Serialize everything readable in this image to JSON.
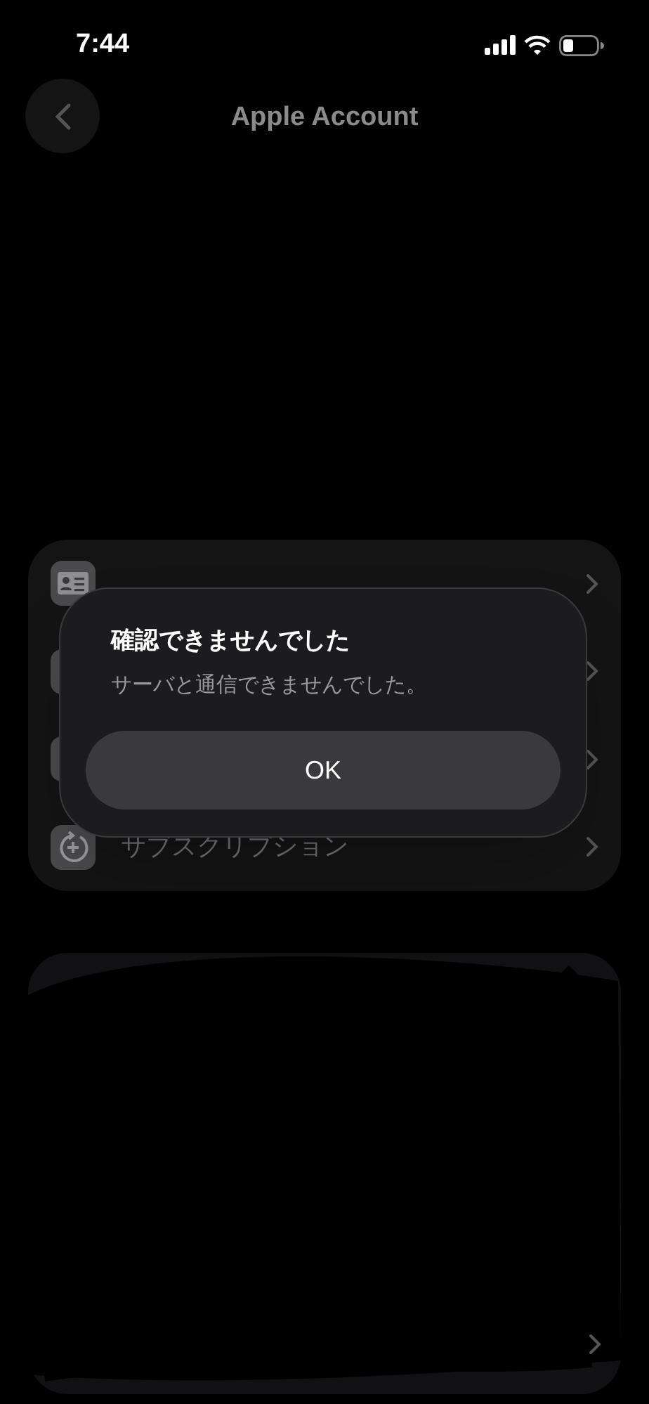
{
  "status_bar": {
    "time": "7:44"
  },
  "nav": {
    "title": "Apple Account"
  },
  "menu": [
    {
      "kind": "contact"
    },
    {
      "kind": "blank"
    },
    {
      "kind": "blank"
    },
    {
      "kind": "subscription",
      "label": "サブスクリプション"
    }
  ],
  "alert": {
    "title": "確認できませんでした",
    "message": "サーバと通信できませんでした。",
    "buttons": [
      "OK"
    ]
  }
}
